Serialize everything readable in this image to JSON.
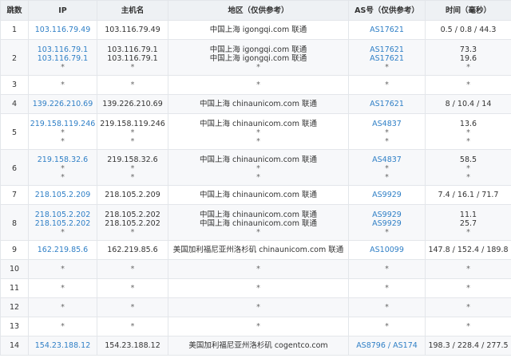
{
  "headers": [
    "跳数",
    "IP",
    "主机名",
    "地区（仅供参考）",
    "AS号（仅供参考）",
    "时间（毫秒）"
  ],
  "rows": [
    {
      "hop": "1",
      "ip": [
        "103.116.79.49"
      ],
      "host": [
        "103.116.79.49"
      ],
      "region": [
        "中国上海 igongqi.com 联通"
      ],
      "as": [
        "AS17621"
      ],
      "time": [
        "0.5 / 0.8 / 44.3"
      ]
    },
    {
      "hop": "2",
      "ip": [
        "103.116.79.1",
        "103.116.79.1",
        "*"
      ],
      "host": [
        "103.116.79.1",
        "103.116.79.1",
        "*"
      ],
      "region": [
        "中国上海 igongqi.com 联通",
        "中国上海 igongqi.com 联通",
        "*"
      ],
      "as": [
        "AS17621",
        "AS17621",
        "*"
      ],
      "time": [
        "73.3",
        "19.6",
        "*"
      ]
    },
    {
      "hop": "3",
      "ip": [
        "*"
      ],
      "host": [
        "*"
      ],
      "region": [
        "*"
      ],
      "as": [
        "*"
      ],
      "time": [
        "*"
      ]
    },
    {
      "hop": "4",
      "ip": [
        "139.226.210.69"
      ],
      "host": [
        "139.226.210.69"
      ],
      "region": [
        "中国上海 chinaunicom.com 联通"
      ],
      "as": [
        "AS17621"
      ],
      "time": [
        "8 / 10.4 / 14"
      ]
    },
    {
      "hop": "5",
      "ip": [
        "219.158.119.246",
        "*",
        "*"
      ],
      "host": [
        "219.158.119.246",
        "*",
        "*"
      ],
      "region": [
        "中国上海 chinaunicom.com 联通",
        "*",
        "*"
      ],
      "as": [
        "AS4837",
        "*",
        "*"
      ],
      "time": [
        "13.6",
        "*",
        "*"
      ]
    },
    {
      "hop": "6",
      "ip": [
        "219.158.32.6",
        "*",
        "*"
      ],
      "host": [
        "219.158.32.6",
        "*",
        "*"
      ],
      "region": [
        "中国上海 chinaunicom.com 联通",
        "*",
        "*"
      ],
      "as": [
        "AS4837",
        "*",
        "*"
      ],
      "time": [
        "58.5",
        "*",
        "*"
      ]
    },
    {
      "hop": "7",
      "ip": [
        "218.105.2.209"
      ],
      "host": [
        "218.105.2.209"
      ],
      "region": [
        "中国上海 chinaunicom.com 联通"
      ],
      "as": [
        "AS9929"
      ],
      "time": [
        "7.4 / 16.1 / 71.7"
      ]
    },
    {
      "hop": "8",
      "ip": [
        "218.105.2.202",
        "218.105.2.202",
        "*"
      ],
      "host": [
        "218.105.2.202",
        "218.105.2.202",
        "*"
      ],
      "region": [
        "中国上海 chinaunicom.com 联通",
        "中国上海 chinaunicom.com 联通",
        "*"
      ],
      "as": [
        "AS9929",
        "AS9929",
        "*"
      ],
      "time": [
        "11.1",
        "25.7",
        "*"
      ]
    },
    {
      "hop": "9",
      "ip": [
        "162.219.85.6"
      ],
      "host": [
        "162.219.85.6"
      ],
      "region": [
        "美国加利福尼亚州洛杉矶 chinaunicom.com 联通"
      ],
      "as": [
        "AS10099"
      ],
      "time": [
        "147.8 / 152.4 / 189.8"
      ]
    },
    {
      "hop": "10",
      "ip": [
        "*"
      ],
      "host": [
        "*"
      ],
      "region": [
        "*"
      ],
      "as": [
        "*"
      ],
      "time": [
        "*"
      ]
    },
    {
      "hop": "11",
      "ip": [
        "*"
      ],
      "host": [
        "*"
      ],
      "region": [
        "*"
      ],
      "as": [
        "*"
      ],
      "time": [
        "*"
      ]
    },
    {
      "hop": "12",
      "ip": [
        "*"
      ],
      "host": [
        "*"
      ],
      "region": [
        "*"
      ],
      "as": [
        "*"
      ],
      "time": [
        "*"
      ]
    },
    {
      "hop": "13",
      "ip": [
        "*"
      ],
      "host": [
        "*"
      ],
      "region": [
        "*"
      ],
      "as": [
        "*"
      ],
      "time": [
        "*"
      ]
    },
    {
      "hop": "14",
      "ip": [
        "154.23.188.12"
      ],
      "host": [
        "154.23.188.12"
      ],
      "region": [
        "美国加利福尼亚州洛杉矶 cogentco.com"
      ],
      "as": [
        "AS8796 / AS174"
      ],
      "time": [
        "198.3 / 228.4 / 277.5"
      ]
    }
  ],
  "colors": {
    "link": "#2f7fc6",
    "header_bg": "#eef1f4",
    "stripe_bg": "#f7f8fa",
    "border": "#e3e6ea"
  }
}
